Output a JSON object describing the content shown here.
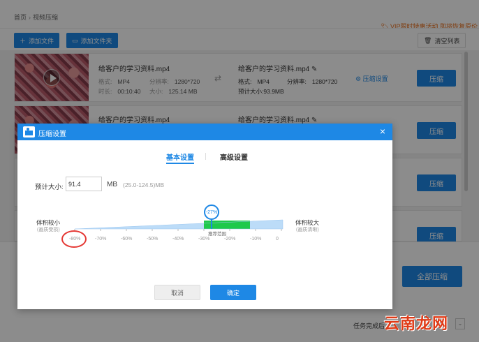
{
  "breadcrumb": {
    "home": "首页",
    "sep": "›",
    "current": "视频压缩"
  },
  "promo": "VIP限时特惠活动  即将恢复原价",
  "toolbar": {
    "add_file": "添加文件",
    "add_folder": "添加文件夹",
    "clear_list": "清空列表"
  },
  "files": [
    {
      "name": "给客户的学习资料.mp4",
      "format_label": "格式:",
      "format": "MP4",
      "resolution_label": "分辨率:",
      "resolution": "1280*720",
      "duration_label": "时长:",
      "duration": "00:10:40",
      "size_label": "大小:",
      "size": "125.14 MB",
      "out_name": "给客户的学习资料.mp4",
      "out_format_label": "格式:",
      "out_format": "MP4",
      "out_resolution_label": "分辨率:",
      "out_resolution": "1280*720",
      "est_label": "预计大小:",
      "est_size": "93.9MB",
      "settings_label": "压缩设置",
      "compress_label": "压缩"
    },
    {
      "name": "给客户的学习资料.mp4",
      "out_name": "给客户的学习资料.mp4",
      "compress_label": "压缩"
    }
  ],
  "row_buttons": [
    "压缩",
    "压缩"
  ],
  "all_compress": "全部压缩",
  "task_done": "任务完成后",
  "dialog": {
    "title": "压缩设置",
    "close": "×",
    "tab_basic": "基本设置",
    "tab_advanced": "高级设置",
    "size_label": "预计大小:",
    "size_value": "91.4",
    "size_unit": "MB",
    "size_range": "(25.0-124.5)MB",
    "left_label": "体积较小",
    "left_sub": "(画质受损)",
    "right_label": "体积较大",
    "right_sub": "(画质清晰)",
    "percent": "-27%",
    "recommend": "推荐范围",
    "ticks": [
      "-80%",
      "-70%",
      "-60%",
      "-50%",
      "-40%",
      "-30%",
      "-20%",
      "-10%",
      "0"
    ],
    "cancel": "取消",
    "ok": "确定"
  },
  "watermark": "云南龙网",
  "colors": {
    "accent": "#1e88e5",
    "recommend": "#1ec94a",
    "annotation": "#e53935"
  }
}
